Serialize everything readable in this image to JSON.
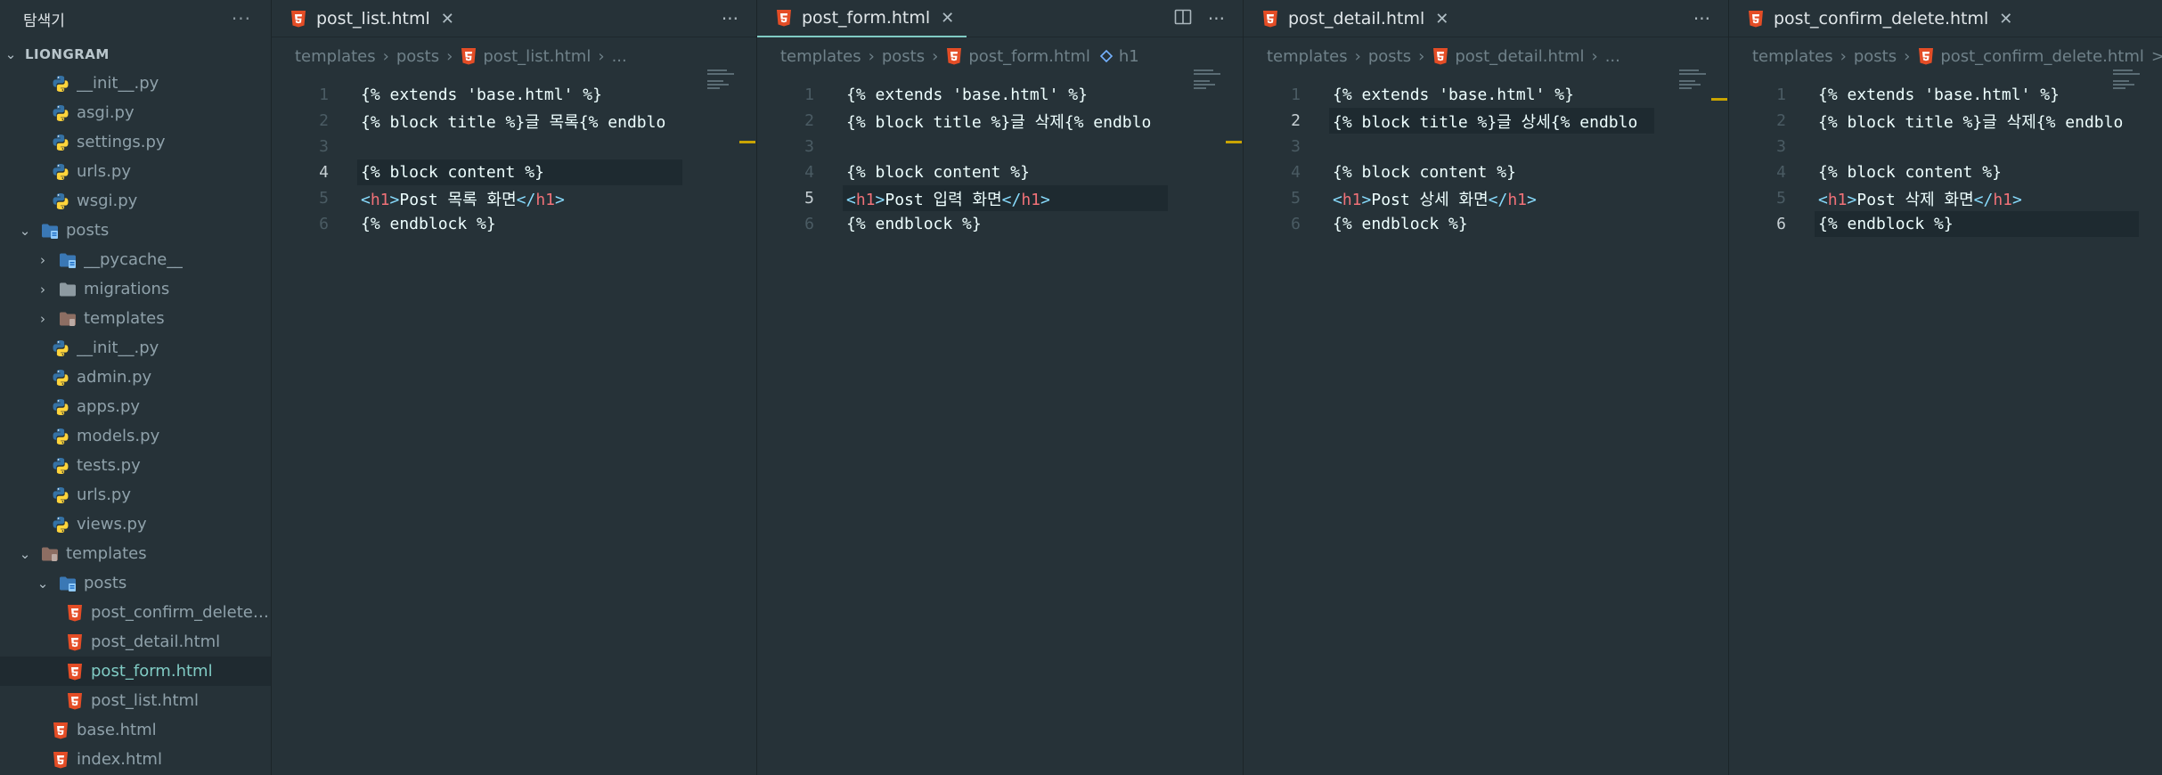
{
  "explorer": {
    "title": "탐색기",
    "more": "···",
    "root": "LIONGRAM",
    "items": [
      {
        "label": "__init__.py",
        "type": "py"
      },
      {
        "label": "asgi.py",
        "type": "py"
      },
      {
        "label": "settings.py",
        "type": "py"
      },
      {
        "label": "urls.py",
        "type": "py"
      },
      {
        "label": "wsgi.py",
        "type": "py"
      },
      {
        "label": "posts",
        "type": "folder-py-open"
      },
      {
        "label": "__pycache__",
        "type": "folder-py"
      },
      {
        "label": "migrations",
        "type": "folder"
      },
      {
        "label": "templates",
        "type": "folder-tpl"
      },
      {
        "label": "__init__.py",
        "type": "py"
      },
      {
        "label": "admin.py",
        "type": "py"
      },
      {
        "label": "apps.py",
        "type": "py"
      },
      {
        "label": "models.py",
        "type": "py"
      },
      {
        "label": "tests.py",
        "type": "py"
      },
      {
        "label": "urls.py",
        "type": "py"
      },
      {
        "label": "views.py",
        "type": "py"
      },
      {
        "label": "templates",
        "type": "folder-tpl-open"
      },
      {
        "label": "posts",
        "type": "folder-py-open"
      },
      {
        "label": "post_confirm_delete....",
        "type": "html"
      },
      {
        "label": "post_detail.html",
        "type": "html"
      },
      {
        "label": "post_form.html",
        "type": "html"
      },
      {
        "label": "post_list.html",
        "type": "html"
      },
      {
        "label": "base.html",
        "type": "html"
      },
      {
        "label": "index.html",
        "type": "html"
      }
    ]
  },
  "groups": [
    {
      "tab": "post_list.html",
      "close": "✕",
      "more": "···",
      "crumbs": {
        "a": "templates",
        "b": "posts",
        "c": "post_list.html",
        "d": "..."
      },
      "lines": {
        "l1": "{% extends 'base.html' %}",
        "l2a": "{% block title %}",
        "l2b": "글 목록",
        "l2c": "{% endblo",
        "l4": "{% block content %}",
        "l5text": "Post 목록 화면",
        "l6": "{% endblock %}"
      }
    },
    {
      "tab": "post_form.html",
      "close": "✕",
      "more": "···",
      "crumbs": {
        "a": "templates",
        "b": "posts",
        "c": "post_form.html",
        "d": "h1"
      },
      "lines": {
        "l1": "{% extends 'base.html' %}",
        "l2a": "{% block title %}",
        "l2b": "글 삭제",
        "l2c": "{% endblo",
        "l4": "{% block content %}",
        "l5text": "Post 입력 화면",
        "l6": "{% endblock %}"
      }
    },
    {
      "tab": "post_detail.html",
      "close": "✕",
      "more": "···",
      "crumbs": {
        "a": "templates",
        "b": "posts",
        "c": "post_detail.html",
        "d": "..."
      },
      "lines": {
        "l1": "{% extends 'base.html' %}",
        "l2a": "{% block title %}",
        "l2b": "글 상세",
        "l2c": "{% endblo",
        "l4": "{% block content %}",
        "l5text": "Post 상세 화면",
        "l6": "{% endblock %}"
      }
    },
    {
      "tab": "post_confirm_delete.html",
      "close": "✕",
      "crumbs": {
        "a": "templates",
        "b": "posts",
        "c": "post_confirm_delete.html",
        "d": ">"
      },
      "lines": {
        "l1": "{% extends 'base.html' %}",
        "l2a": "{% block title %}",
        "l2b": "글 삭제",
        "l2c": "{% endblo",
        "l4": "{% block content %}",
        "l5text": "Post 삭제 화면",
        "l6": "{% endblock %}"
      }
    }
  ],
  "line_numbers": [
    "1",
    "2",
    "3",
    "4",
    "5",
    "6"
  ],
  "tag_name": "h1",
  "colors": {
    "accent": "#80cbc4",
    "html_icon": "#e44d26",
    "py_blue": "#3572a5",
    "py_yellow": "#ffd43b",
    "tag": "#f07178",
    "bracket": "#89ddff"
  }
}
